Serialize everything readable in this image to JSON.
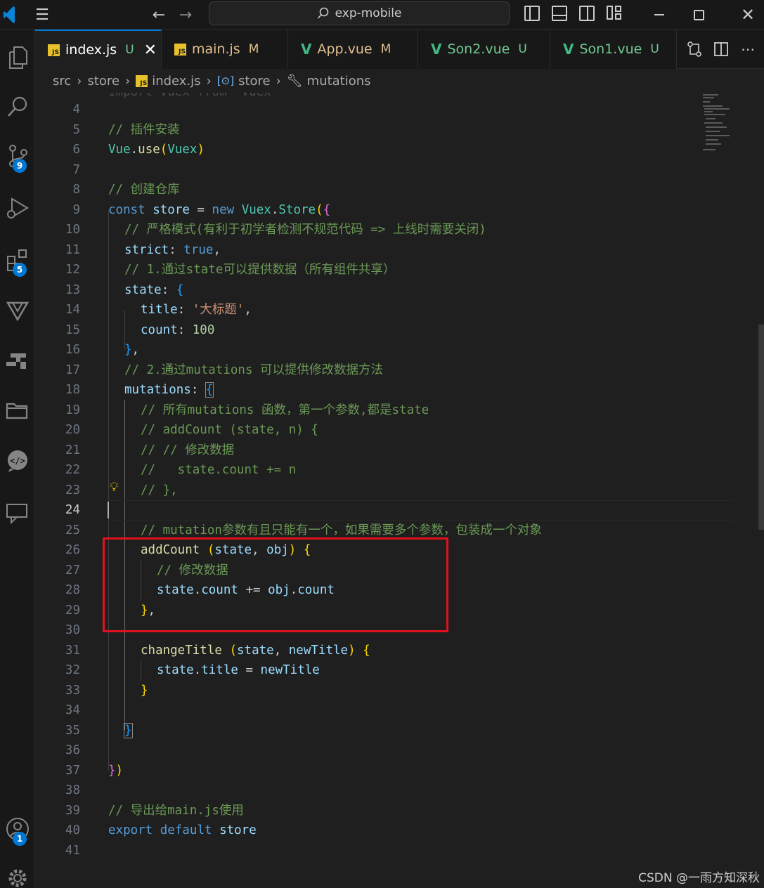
{
  "titlebar": {
    "search_text": "exp-mobile"
  },
  "activity_bar": {
    "source_control_badge": "9",
    "extensions_badge": "5",
    "accounts_badge": "1"
  },
  "tabs": [
    {
      "label": "index.js",
      "status": "U",
      "icon": "js-file-icon",
      "active": true
    },
    {
      "label": "main.js",
      "status": "M",
      "icon": "js-file-icon",
      "active": false
    },
    {
      "label": "App.vue",
      "status": "M",
      "icon": "vue-file-icon",
      "active": false
    },
    {
      "label": "Son2.vue",
      "status": "U",
      "icon": "vue-file-icon",
      "active": false
    },
    {
      "label": "Son1.vue",
      "status": "U",
      "icon": "vue-file-icon",
      "active": false
    }
  ],
  "breadcrumb": {
    "folder1": "src",
    "folder2": "store",
    "file": "index.js",
    "symbol1": "store",
    "symbol2": "mutations"
  },
  "editor": {
    "top_partial_line": "import Vuex from 'vuex'",
    "line_numbers": [
      "4",
      "5",
      "6",
      "7",
      "8",
      "9",
      "10",
      "11",
      "12",
      "13",
      "14",
      "15",
      "16",
      "17",
      "18",
      "19",
      "20",
      "21",
      "22",
      "23",
      "24",
      "25",
      "26",
      "27",
      "28",
      "29",
      "30",
      "31",
      "32",
      "33",
      "34",
      "35",
      "36",
      "37",
      "38",
      "39",
      "40",
      "41"
    ],
    "current_line": "24",
    "code": {
      "l5_comment": "// 插件安装",
      "l6_vue": "Vue",
      "l6_use": "use",
      "l6_vuex": "Vuex",
      "l8_comment": "// 创建仓库",
      "l9_const": "const",
      "l9_store": "store",
      "l9_new": "new",
      "l9_vuex": "Vuex",
      "l9_class": "Store",
      "l10_comment": "// 严格模式(有利于初学者检测不规范代码 => 上线时需要关闭)",
      "l11_key": "strict",
      "l11_val": "true",
      "l12_comment": "// 1.通过state可以提供数据（所有组件共享）",
      "l13_key": "state",
      "l14_key": "title",
      "l14_val": "'大标题'",
      "l15_key": "count",
      "l15_val": "100",
      "l17_comment": "// 2.通过mutations 可以提供修改数据方法",
      "l18_key": "mutations",
      "l19_comment": "// 所有mutations 函数，第一个参数,都是state",
      "l20_comment": "// addCount (state, n) {",
      "l21_comment": "// // 修改数据",
      "l22_comment": "//   state.count += n",
      "l23_comment": "// },",
      "l25_comment": "// mutation参数有且只能有一个，如果需要多个参数，包装成一个对象",
      "l26_fn": "addCount",
      "l26_p1": "state",
      "l26_p2": "obj",
      "l27_comment": "// 修改数据",
      "l28_a": "state",
      "l28_b": "count",
      "l28_c": "obj",
      "l28_d": "count",
      "l31_fn": "changeTitle",
      "l31_p1": "state",
      "l31_p2": "newTitle",
      "l32_a": "state",
      "l32_b": "title",
      "l32_c": "newTitle",
      "l39_comment": "// 导出给main.js使用",
      "l40_export": "export",
      "l40_default": "default",
      "l40_store": "store"
    }
  },
  "watermark": "CSDN @一雨方知深秋",
  "colors": {
    "accent": "#0078d4",
    "highlight_box": "#e0121d"
  }
}
